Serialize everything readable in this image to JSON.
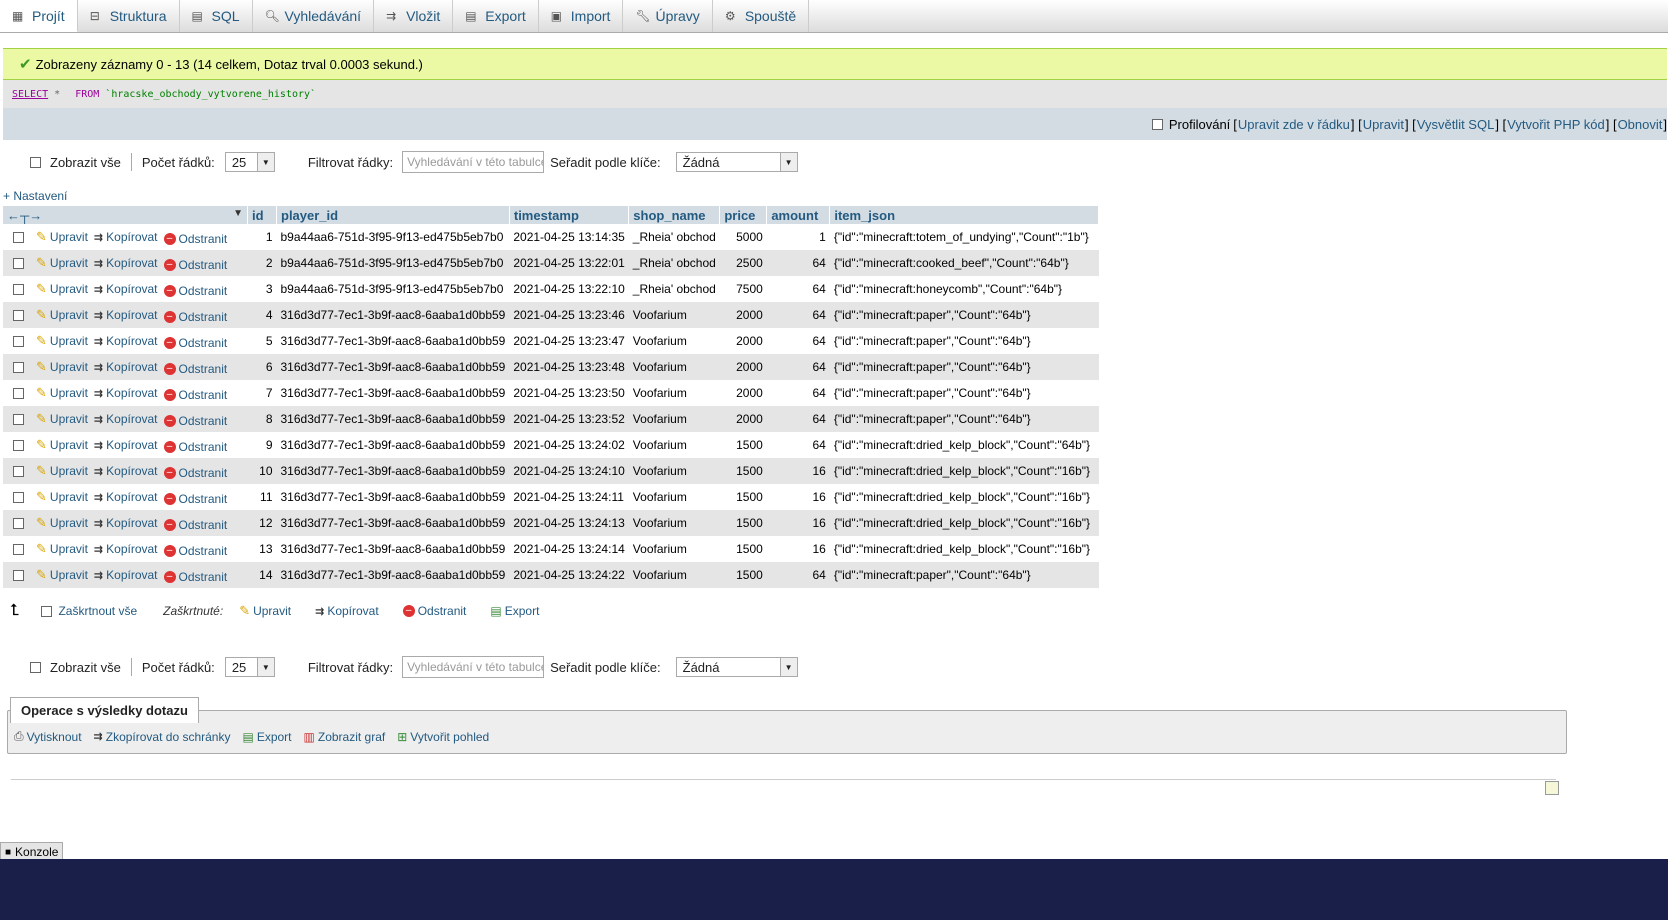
{
  "tabs": [
    {
      "label": "Projít",
      "icon": "browse-icon",
      "active": true
    },
    {
      "label": "Struktura",
      "icon": "structure-icon"
    },
    {
      "label": "SQL",
      "icon": "sql-icon"
    },
    {
      "label": "Vyhledávání",
      "icon": "search-icon"
    },
    {
      "label": "Vložit",
      "icon": "insert-icon"
    },
    {
      "label": "Export",
      "icon": "export-icon"
    },
    {
      "label": "Import",
      "icon": "import-icon"
    },
    {
      "label": "Úpravy",
      "icon": "wrench-icon"
    },
    {
      "label": "Spouště",
      "icon": "triggers-icon"
    }
  ],
  "notice": "Zobrazeny záznamy 0 - 13 (14 celkem, Dotaz trval 0.0003 sekund.)",
  "sql": {
    "select": "SELECT",
    "star": " * ",
    "from": "FROM",
    "table": " `hracske_obchody_vytvorene_history`"
  },
  "sqltools": {
    "profiling": "Profilování",
    "edit_inline": "Upravit zde v řádku",
    "edit": "Upravit",
    "explain": "Vysvětlit SQL",
    "php": "Vytvořit PHP kód",
    "refresh": "Obnovit"
  },
  "nav": {
    "show_all": "Zobrazit vše",
    "rows_label": "Počet řádků:",
    "rows_value": "25",
    "filter_label": "Filtrovat řádky:",
    "filter_placeholder": "Vyhledávání v této tabulce",
    "sort_label": "Seřadit podle klíče:",
    "sort_value": "Žádná"
  },
  "settings_link": "+ Nastavení",
  "columns": [
    "id",
    "player_id",
    "timestamp",
    "shop_name",
    "price",
    "amount",
    "item_json"
  ],
  "actions": {
    "edit": "Upravit",
    "copy": "Kopírovat",
    "delete": "Odstranit"
  },
  "rows": [
    {
      "id": "1",
      "player_id": "b9a44aa6-751d-3f95-9f13-ed475b5eb7b0",
      "timestamp": "2021-04-25 13:14:35",
      "shop_name": "_Rheia' obchod",
      "price": "5000",
      "amount": "1",
      "item_json": "{\"id\":\"minecraft:totem_of_undying\",\"Count\":\"1b\"}"
    },
    {
      "id": "2",
      "player_id": "b9a44aa6-751d-3f95-9f13-ed475b5eb7b0",
      "timestamp": "2021-04-25 13:22:01",
      "shop_name": "_Rheia' obchod",
      "price": "2500",
      "amount": "64",
      "item_json": "{\"id\":\"minecraft:cooked_beef\",\"Count\":\"64b\"}"
    },
    {
      "id": "3",
      "player_id": "b9a44aa6-751d-3f95-9f13-ed475b5eb7b0",
      "timestamp": "2021-04-25 13:22:10",
      "shop_name": "_Rheia' obchod",
      "price": "7500",
      "amount": "64",
      "item_json": "{\"id\":\"minecraft:honeycomb\",\"Count\":\"64b\"}"
    },
    {
      "id": "4",
      "player_id": "316d3d77-7ec1-3b9f-aac8-6aaba1d0bb59",
      "timestamp": "2021-04-25 13:23:46",
      "shop_name": "Voofarium",
      "price": "2000",
      "amount": "64",
      "item_json": "{\"id\":\"minecraft:paper\",\"Count\":\"64b\"}"
    },
    {
      "id": "5",
      "player_id": "316d3d77-7ec1-3b9f-aac8-6aaba1d0bb59",
      "timestamp": "2021-04-25 13:23:47",
      "shop_name": "Voofarium",
      "price": "2000",
      "amount": "64",
      "item_json": "{\"id\":\"minecraft:paper\",\"Count\":\"64b\"}"
    },
    {
      "id": "6",
      "player_id": "316d3d77-7ec1-3b9f-aac8-6aaba1d0bb59",
      "timestamp": "2021-04-25 13:23:48",
      "shop_name": "Voofarium",
      "price": "2000",
      "amount": "64",
      "item_json": "{\"id\":\"minecraft:paper\",\"Count\":\"64b\"}"
    },
    {
      "id": "7",
      "player_id": "316d3d77-7ec1-3b9f-aac8-6aaba1d0bb59",
      "timestamp": "2021-04-25 13:23:50",
      "shop_name": "Voofarium",
      "price": "2000",
      "amount": "64",
      "item_json": "{\"id\":\"minecraft:paper\",\"Count\":\"64b\"}"
    },
    {
      "id": "8",
      "player_id": "316d3d77-7ec1-3b9f-aac8-6aaba1d0bb59",
      "timestamp": "2021-04-25 13:23:52",
      "shop_name": "Voofarium",
      "price": "2000",
      "amount": "64",
      "item_json": "{\"id\":\"minecraft:paper\",\"Count\":\"64b\"}"
    },
    {
      "id": "9",
      "player_id": "316d3d77-7ec1-3b9f-aac8-6aaba1d0bb59",
      "timestamp": "2021-04-25 13:24:02",
      "shop_name": "Voofarium",
      "price": "1500",
      "amount": "64",
      "item_json": "{\"id\":\"minecraft:dried_kelp_block\",\"Count\":\"64b\"}"
    },
    {
      "id": "10",
      "player_id": "316d3d77-7ec1-3b9f-aac8-6aaba1d0bb59",
      "timestamp": "2021-04-25 13:24:10",
      "shop_name": "Voofarium",
      "price": "1500",
      "amount": "16",
      "item_json": "{\"id\":\"minecraft:dried_kelp_block\",\"Count\":\"16b\"}"
    },
    {
      "id": "11",
      "player_id": "316d3d77-7ec1-3b9f-aac8-6aaba1d0bb59",
      "timestamp": "2021-04-25 13:24:11",
      "shop_name": "Voofarium",
      "price": "1500",
      "amount": "16",
      "item_json": "{\"id\":\"minecraft:dried_kelp_block\",\"Count\":\"16b\"}"
    },
    {
      "id": "12",
      "player_id": "316d3d77-7ec1-3b9f-aac8-6aaba1d0bb59",
      "timestamp": "2021-04-25 13:24:13",
      "shop_name": "Voofarium",
      "price": "1500",
      "amount": "16",
      "item_json": "{\"id\":\"minecraft:dried_kelp_block\",\"Count\":\"16b\"}"
    },
    {
      "id": "13",
      "player_id": "316d3d77-7ec1-3b9f-aac8-6aaba1d0bb59",
      "timestamp": "2021-04-25 13:24:14",
      "shop_name": "Voofarium",
      "price": "1500",
      "amount": "16",
      "item_json": "{\"id\":\"minecraft:dried_kelp_block\",\"Count\":\"16b\"}"
    },
    {
      "id": "14",
      "player_id": "316d3d77-7ec1-3b9f-aac8-6aaba1d0bb59",
      "timestamp": "2021-04-25 13:24:22",
      "shop_name": "Voofarium",
      "price": "1500",
      "amount": "64",
      "item_json": "{\"id\":\"minecraft:paper\",\"Count\":\"64b\"}"
    }
  ],
  "bulk": {
    "check_all": "Zaškrtnout vše",
    "checked_label": "Zaškrtnuté:",
    "edit": "Upravit",
    "copy": "Kopírovat",
    "delete": "Odstranit",
    "export": "Export"
  },
  "ops": {
    "title": "Operace s výsledky dotazu",
    "print": "Vytisknout",
    "clipboard": "Zkopírovat do schránky",
    "export": "Export",
    "chart": "Zobrazit graf",
    "view": "Vytvořit pohled"
  },
  "console": "Konzole",
  "colors": {
    "accent": "#235a81",
    "notice_bg": "#ebf8a4",
    "header_bg": "#d3dce3",
    "row_alt": "#e5e5e5"
  }
}
